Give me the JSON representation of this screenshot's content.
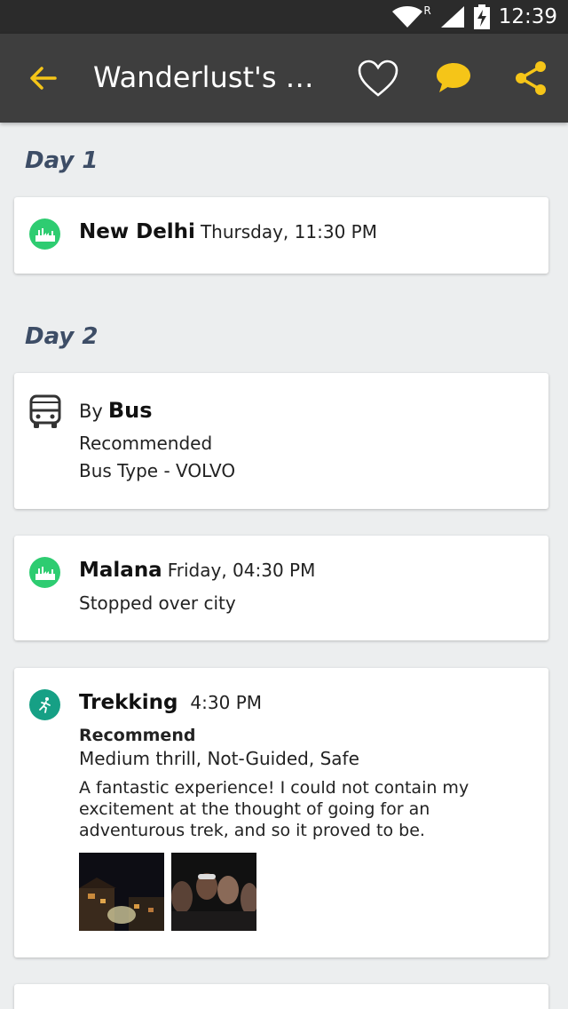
{
  "status": {
    "time": "12:39",
    "roaming": "R"
  },
  "header": {
    "title": "Wanderlust's H..."
  },
  "days": [
    {
      "label": "Day 1"
    },
    {
      "label": "Day 2"
    }
  ],
  "cards": {
    "delhi": {
      "place": "New Delhi",
      "time": "Thursday, 11:30 PM"
    },
    "bus": {
      "by": "By",
      "mode": "Bus",
      "line1": "Recommended",
      "line2": "Bus Type - VOLVO"
    },
    "malana": {
      "place": "Malana",
      "time": "Friday, 04:30 PM",
      "note": "Stopped over city"
    },
    "trek": {
      "title": "Trekking",
      "time": "4:30 PM",
      "recommend": "Recommend",
      "attributes": "Medium thrill, Not-Guided, Safe",
      "description": "A fantastic experience! I could not contain my excitement at the thought of going for an adventurous trek, and so it proved to be."
    }
  },
  "colors": {
    "accent": "#f5c518",
    "app_bar": "#3e3e3e",
    "day_label": "#3d4d66",
    "place_icon": "#2ecc71",
    "activity_icon": "#16a085"
  },
  "icons": [
    "back-arrow-icon",
    "heart-icon",
    "chat-icon",
    "share-icon",
    "city-icon",
    "bus-icon",
    "trekking-icon"
  ]
}
